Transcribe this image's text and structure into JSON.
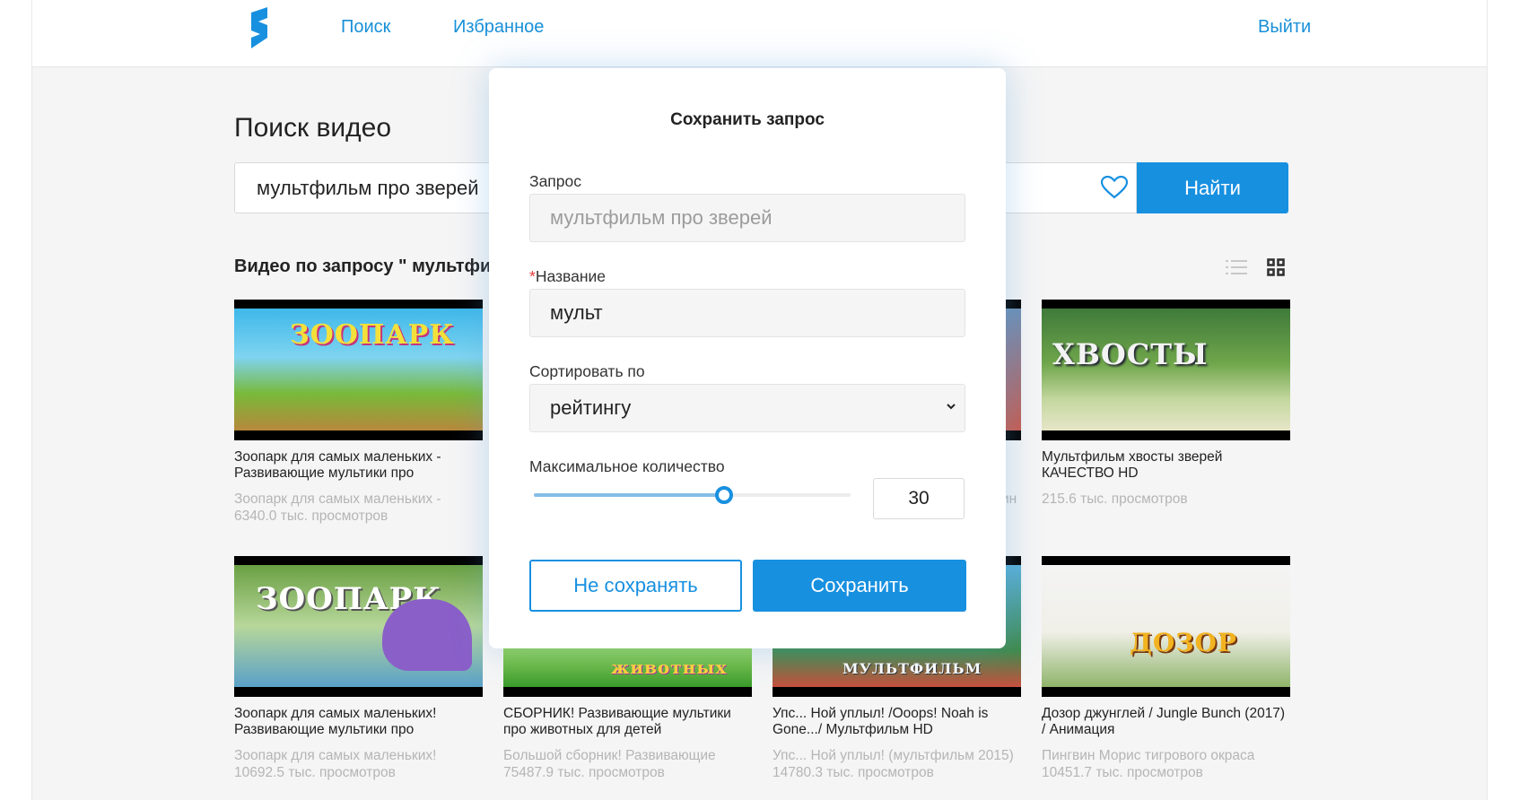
{
  "header": {
    "nav": [
      "Поиск",
      "Избранное"
    ],
    "logout": "Выйти"
  },
  "search": {
    "title": "Поиск видео",
    "query": "мультфильм про зверей",
    "button": "Найти",
    "results_label": "Видео по запросу \" мультфильм про зверей\""
  },
  "videos": [
    {
      "title": "Зоопарк для самых маленьких - Развивающие мультики про",
      "desc": "Зоопарк для самых маленьких -",
      "views": "6340.0 тыс. просмотров",
      "thumb_text": "ЗООПАРК"
    },
    {
      "title": "",
      "desc": "",
      "views": "",
      "thumb_text": ""
    },
    {
      "title": "",
      "desc": "ин",
      "views": "",
      "thumb_text": ""
    },
    {
      "title": "Мультфильм хвосты зверей КАЧЕСТВО HD",
      "desc": "",
      "views": "215.6 тыс. просмотров",
      "thumb_text": "ХВОСТЫ"
    },
    {
      "title": "Зоопарк для самых маленьких! Развивающие мультики про",
      "desc": "Зоопарк для самых маленьких!",
      "views": "10692.5 тыс. просмотров",
      "thumb_text": "ЗООПАРК"
    },
    {
      "title": "СБОРНИК! Развивающие мультики про животных для детей",
      "desc": "Большой сборник! Развивающие",
      "views": "75487.9 тыс. просмотров",
      "thumb_text": "животных"
    },
    {
      "title": "Упс... Ной уплыл! /Ooops! Noah is Gone.../ Мультфильм HD",
      "desc": "Упс... Ной уплыл! (мультфильм 2015)",
      "views": "14780.3 тыс. просмотров",
      "thumb_text": "МУЛЬТФИЛЬМ"
    },
    {
      "title": "Дозор джунглей / Jungle Bunch (2017) / Анимация",
      "desc": "Пингвин Морис тигрового окраса",
      "views": "10451.7 тыс. просмотров",
      "thumb_text": "ДОЗОР"
    }
  ],
  "modal": {
    "title": "Сохранить запрос",
    "query_label": "Запрос",
    "query_value": "мультфильм про зверей",
    "name_required_mark": "*",
    "name_label": "Название",
    "name_value": "мульт",
    "sort_label": "Сортировать по",
    "sort_value": "рейтингу",
    "max_label": "Максимальное количество",
    "max_value": "30",
    "slider_fraction": 0.6,
    "cancel": "Не сохранять",
    "save": "Сохранить"
  },
  "colors": {
    "accent": "#1890e0",
    "link": "#1890d8"
  }
}
